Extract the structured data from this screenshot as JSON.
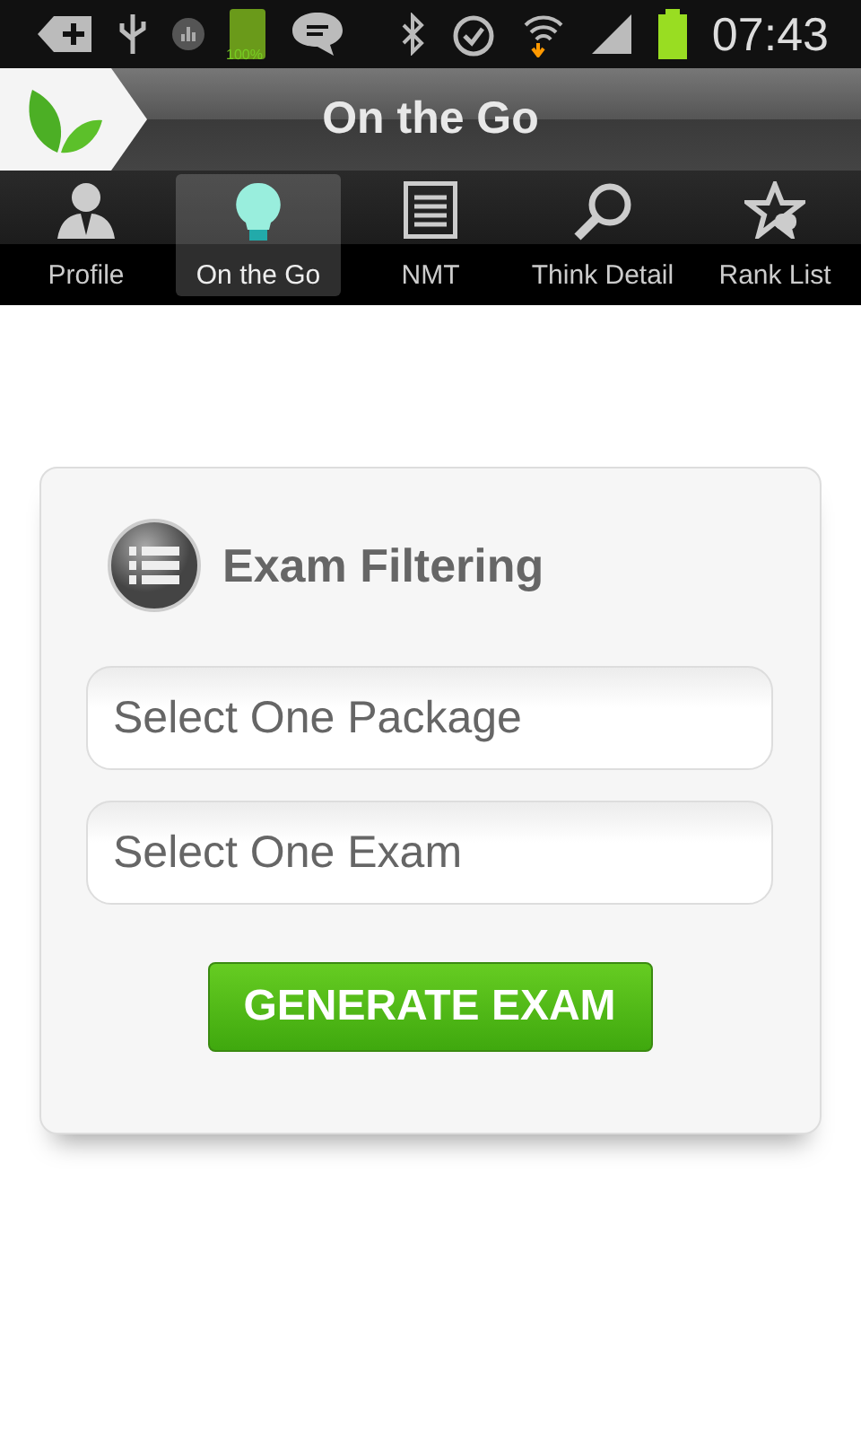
{
  "status_bar": {
    "battery_label": "100%",
    "time": "07:43"
  },
  "header": {
    "title": "On the Go"
  },
  "tabs": [
    {
      "label": "Profile",
      "selected": false
    },
    {
      "label": "On the Go",
      "selected": true
    },
    {
      "label": "NMT",
      "selected": false
    },
    {
      "label": "Think Detail",
      "selected": false
    },
    {
      "label": "Rank List",
      "selected": false
    }
  ],
  "card": {
    "title": "Exam Filtering",
    "fields": [
      {
        "placeholder": "Select One Package"
      },
      {
        "placeholder": "Select One Exam"
      }
    ],
    "button": "GENERATE EXAM"
  }
}
